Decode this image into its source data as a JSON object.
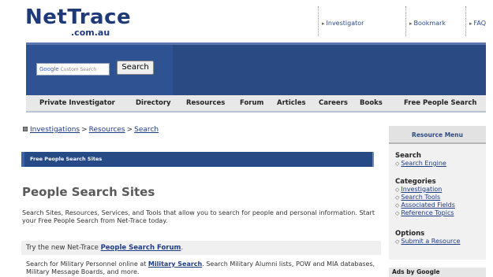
{
  "header": {
    "logo_main": "NetTrace",
    "logo_sub": ".com.au",
    "links": [
      "Investigator",
      "Bookmark",
      "FAQ"
    ]
  },
  "search": {
    "placeholder_brand": "Google",
    "placeholder_text": "Custom Search",
    "button": "Search"
  },
  "nav": [
    "Private Investigator",
    "Directory",
    "Resources",
    "Forum",
    "Articles",
    "Careers",
    "Books",
    "Free People Search"
  ],
  "breadcrumb": [
    "Investigations",
    "Resources",
    "Search"
  ],
  "section_bar": "Free People Search Sites",
  "page_title": "People Search Sites",
  "intro": "Search Sites, Resources, Services, and Tools that allow you to search for people and personal information. Start your Free People Search from Net-Trace today.",
  "try_row": {
    "prefix": "Try the new Net-Trace ",
    "link": "People Search Forum",
    "suffix": "."
  },
  "military_row": {
    "prefix": "Search for Military Personnel online at ",
    "link": "Military Search",
    "suffix": ". Search Military Alumni lists, POW and MIA databases, Military Message Boards, and more."
  },
  "sidebar": {
    "title": "Resource Menu",
    "groups": [
      {
        "title": "Search",
        "links": [
          "Search Engine"
        ]
      },
      {
        "title": "Categories",
        "links": [
          "Investigation",
          "Search Tools",
          "Associated Fields",
          "Reference Topics"
        ]
      },
      {
        "title": "Options",
        "links": [
          "Submit a Resource"
        ]
      }
    ],
    "ads_label": "Ads by Google"
  }
}
